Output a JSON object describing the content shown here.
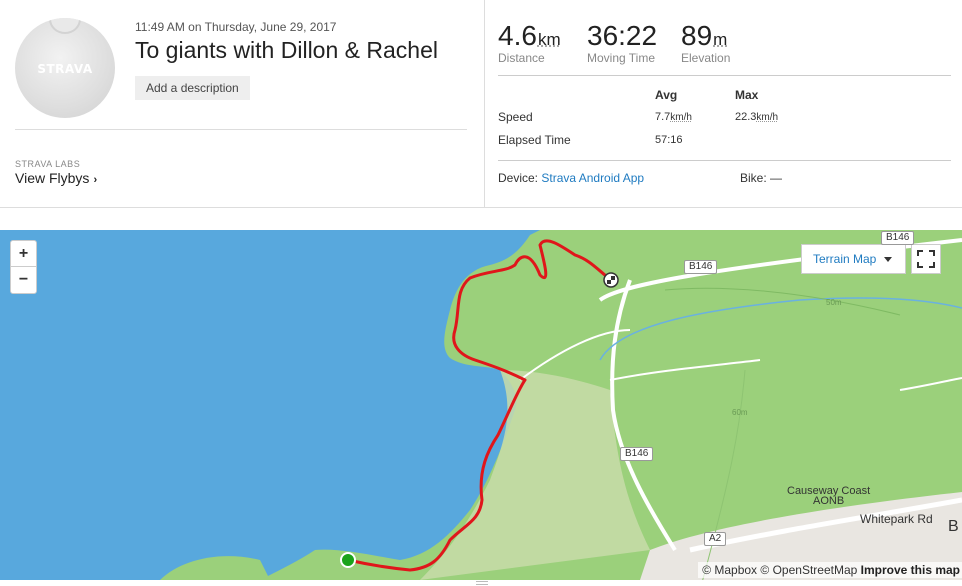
{
  "activity": {
    "date": "11:49 AM on Thursday, June 29, 2017",
    "title": "To giants with Dillon & Rachel",
    "add_description_label": "Add a description",
    "avatar_brand": "STRAVA"
  },
  "labs": {
    "section_label": "STRAVA LABS",
    "flybys_label": "View Flybys",
    "chevron": "›"
  },
  "stats": {
    "distance": {
      "value": "4.6",
      "unit": "km",
      "label": "Distance"
    },
    "moving_time": {
      "value": "36:22",
      "label": "Moving Time"
    },
    "elevation": {
      "value": "89",
      "unit": "m",
      "label": "Elevation"
    }
  },
  "details": {
    "avg_header": "Avg",
    "max_header": "Max",
    "speed_label": "Speed",
    "speed_avg": "7.7",
    "speed_max": "22.3",
    "speed_unit": "km/h",
    "elapsed_label": "Elapsed Time",
    "elapsed_avg": "57:16"
  },
  "device": {
    "label": "Device:",
    "value": "Strava Android App",
    "bike_label": "Bike:",
    "bike_value": "—"
  },
  "map": {
    "zoom_in": "+",
    "zoom_out": "−",
    "map_type": "Terrain Map",
    "road_labels": [
      "B146",
      "B146",
      "B146",
      "A2"
    ],
    "place_label_1": "Causeway Coast",
    "place_label_2": "AONB",
    "street_label": "Whitepark Rd",
    "contour_50": "50m",
    "contour_60": "60m",
    "edge_letter": "B",
    "attribution_mapbox": "© Mapbox",
    "attribution_osm": "© OpenStreetMap",
    "improve_label": "Improve this map",
    "colors": {
      "water": "#58a8dd",
      "land": "#9bd07b",
      "route": "#e0161b",
      "start": "#1aa31a"
    }
  }
}
